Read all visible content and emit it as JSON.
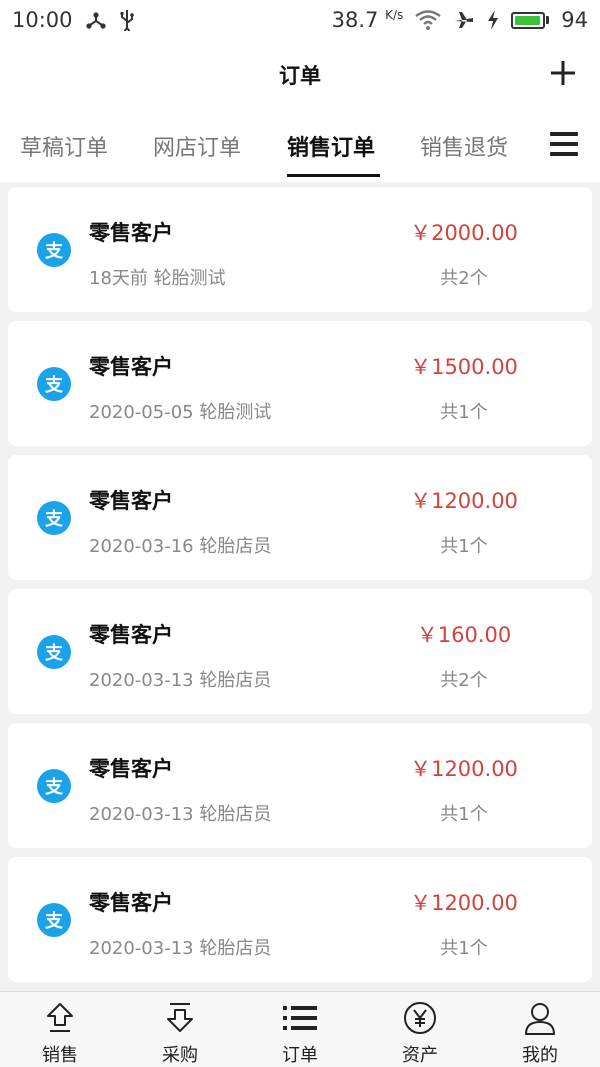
{
  "status_bar": {
    "time": "10:00",
    "net_speed": "38.7",
    "net_unit": "K/s",
    "battery": "94",
    "battery_level_percent": 94,
    "battery_color": "#3cc13c"
  },
  "header": {
    "title": "订单",
    "add_icon": "plus-icon"
  },
  "tabs": {
    "items": [
      {
        "label": "草稿订单",
        "active": false
      },
      {
        "label": "网店订单",
        "active": false
      },
      {
        "label": "销售订单",
        "active": true
      },
      {
        "label": "销售退货",
        "active": false
      }
    ],
    "menu_icon": "hamburger-menu-icon"
  },
  "orders": [
    {
      "customer": "零售客户",
      "time": "18天前",
      "store": "轮胎测试",
      "amount": "￥2000.00",
      "count": "共2个",
      "pay_icon": "支"
    },
    {
      "customer": "零售客户",
      "time": "2020-05-05",
      "store": "轮胎测试",
      "amount": "￥1500.00",
      "count": "共1个",
      "pay_icon": "支"
    },
    {
      "customer": "零售客户",
      "time": "2020-03-16",
      "store": "轮胎店员",
      "amount": "￥1200.00",
      "count": "共1个",
      "pay_icon": "支"
    },
    {
      "customer": "零售客户",
      "time": "2020-03-13",
      "store": "轮胎店员",
      "amount": "￥160.00",
      "count": "共2个",
      "pay_icon": "支"
    },
    {
      "customer": "零售客户",
      "time": "2020-03-13",
      "store": "轮胎店员",
      "amount": "￥1200.00",
      "count": "共1个",
      "pay_icon": "支"
    },
    {
      "customer": "零售客户",
      "time": "2020-03-13",
      "store": "轮胎店员",
      "amount": "￥1200.00",
      "count": "共1个",
      "pay_icon": "支"
    }
  ],
  "bottom_nav": [
    {
      "label": "销售",
      "icon": "upload-arrow-icon"
    },
    {
      "label": "采购",
      "icon": "download-arrow-icon"
    },
    {
      "label": "订单",
      "icon": "list-icon"
    },
    {
      "label": "资产",
      "icon": "yen-coin-icon"
    },
    {
      "label": "我的",
      "icon": "person-icon"
    }
  ],
  "colors": {
    "amount": "#d0443e",
    "pay_icon": "#1aa3e8",
    "accent_underline": "#111111"
  }
}
